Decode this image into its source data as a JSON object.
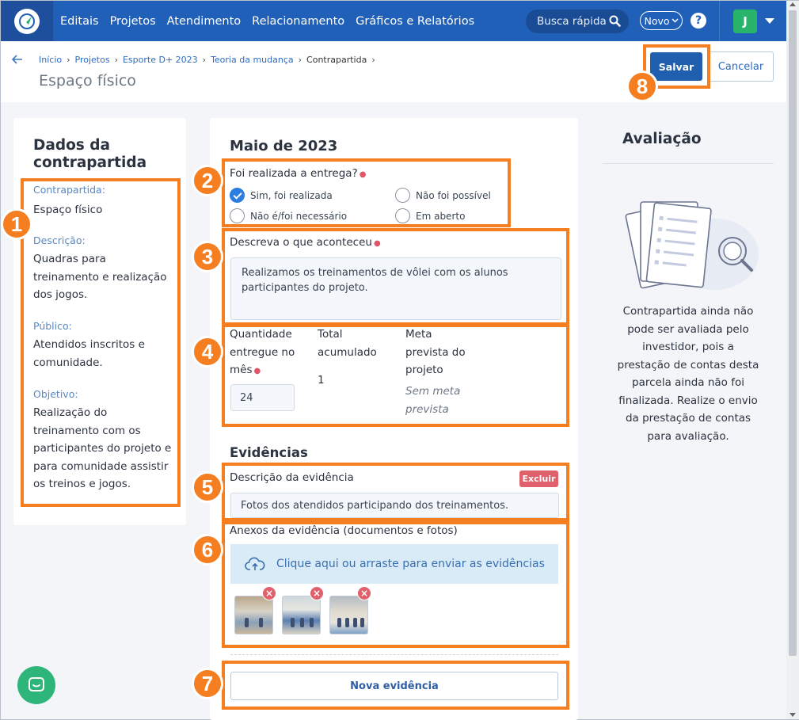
{
  "nav": {
    "items": [
      "Editais",
      "Projetos",
      "Atendimento",
      "Relacionamento",
      "Gráficos e Relatórios"
    ],
    "search_placeholder": "Busca rápida",
    "novo_label": "Novo",
    "help_label": "?",
    "avatar_initial": "J"
  },
  "breadcrumb": {
    "items": [
      "Início",
      "Projetos",
      "Esporte D+ 2023",
      "Teoria da mudança"
    ],
    "current": "Contrapartida"
  },
  "page": {
    "title": "Espaço físico",
    "save_label": "Salvar",
    "cancel_label": "Cancelar"
  },
  "left": {
    "title": "Dados da contrapartida",
    "fields": [
      {
        "label": "Contrapartida:",
        "value": "Espaço físico"
      },
      {
        "label": "Descrição:",
        "value": "Quadras para treinamento e realização dos jogos."
      },
      {
        "label": "Público:",
        "value": "Atendidos inscritos e comunidade."
      },
      {
        "label": "Objetivo:",
        "value": "Realização do treinamento com os participantes do projeto e para comunidade assistir os treinos e jogos."
      }
    ]
  },
  "main": {
    "period": "Maio de 2023",
    "delivery_question": "Foi realizada a entrega?",
    "options": [
      {
        "label": "Sim, foi realizada",
        "selected": true
      },
      {
        "label": "Não foi possível",
        "selected": false
      },
      {
        "label": "Não é/foi necessário",
        "selected": false
      },
      {
        "label": "Em aberto",
        "selected": false
      }
    ],
    "describe_label": "Descreva o que aconteceu",
    "describe_value": "Realizamos os treinamentos de vôlei com os alunos participantes do projeto.",
    "qty_label": "Quantidade entregue no mês",
    "qty_value": "24",
    "total_label": "Total acumulado",
    "total_value": "1",
    "meta_label": "Meta prevista do projeto",
    "meta_value": "Sem meta prevista",
    "evidence_title": "Evidências",
    "evidence_desc_label": "Descrição da evidência",
    "delete_label": "Excluir",
    "evidence_desc_value": "Fotos dos atendidos participando dos treinamentos.",
    "attachments_label": "Anexos da evidência (documentos e fotos)",
    "upload_text": "Clique aqui ou arraste para enviar as evidências",
    "remove_glyph": "×",
    "new_evidence_label": "Nova evidência"
  },
  "right": {
    "title": "Avaliação",
    "message": "Contrapartida ainda não pode ser avaliada pelo investidor, pois a prestação de contas desta parcela ainda não foi finalizada. Realize o envio da prestação de contas para avaliação."
  },
  "annotations": [
    "1",
    "2",
    "3",
    "4",
    "5",
    "6",
    "7",
    "8"
  ],
  "colors": {
    "nav": "#2160b8",
    "primary": "#1f5fae",
    "annotation": "#f47e20",
    "danger": "#e0606c",
    "chat": "#2db57a"
  },
  "icons": [
    "logo-icon",
    "search-icon",
    "chevron-down-icon",
    "help-icon",
    "back-arrow-icon",
    "cloud-upload-icon",
    "document-magnifier-icon",
    "chat-icon"
  ]
}
